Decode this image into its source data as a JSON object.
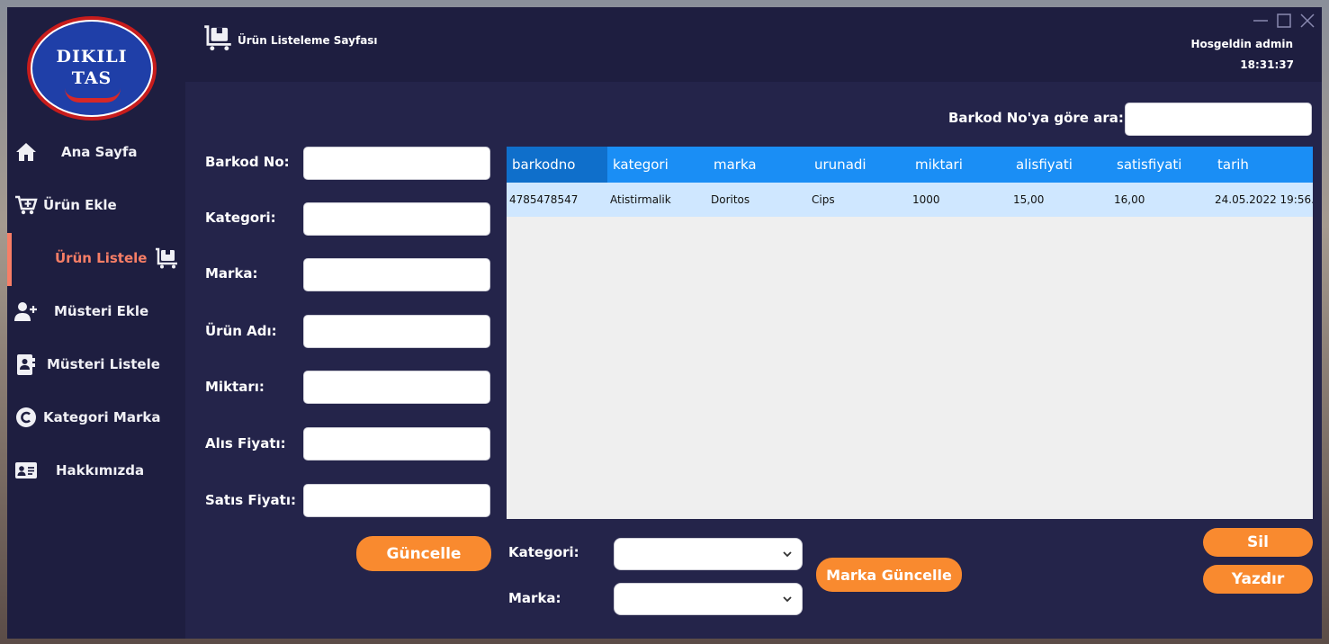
{
  "logo": {
    "line1": "DIKILI",
    "line2": "TAS"
  },
  "sidebar": {
    "items": [
      {
        "label": "Ana Sayfa",
        "icon": "home-icon"
      },
      {
        "label": "Ürün Ekle",
        "icon": "cart-plus-icon"
      },
      {
        "label": "Ürün Listele",
        "icon": "cart-flatbed-icon",
        "active": true
      },
      {
        "label": "Müsteri Ekle",
        "icon": "user-plus-icon"
      },
      {
        "label": "Müsteri Listele",
        "icon": "address-book-icon"
      },
      {
        "label": "Kategori Marka",
        "icon": "copyright-icon"
      },
      {
        "label": "Hakkımızda",
        "icon": "id-card-icon"
      }
    ]
  },
  "header": {
    "title": "Ürün Listeleme Sayfası",
    "icon": "cart-flatbed-icon",
    "welcome": "Hosgeldin admin",
    "time": "18:31:37"
  },
  "window_controls": [
    "minimize-icon",
    "maximize-icon",
    "close-icon"
  ],
  "form": {
    "fields": [
      {
        "label": "Barkod No:",
        "value": ""
      },
      {
        "label": "Kategori:",
        "value": ""
      },
      {
        "label": "Marka:",
        "value": ""
      },
      {
        "label": "Ürün Adı:",
        "value": ""
      },
      {
        "label": "Miktarı:",
        "value": ""
      },
      {
        "label": "Alıs Fiyatı:",
        "value": ""
      },
      {
        "label": "Satıs Fiyatı:",
        "value": ""
      }
    ],
    "update_button": "Güncelle"
  },
  "search": {
    "label": "Barkod No'ya göre ara:",
    "value": ""
  },
  "grid": {
    "columns": [
      "barkodno",
      "kategori",
      "marka",
      "urunadi",
      "miktari",
      "alisfiyati",
      "satisfiyati",
      "tarih"
    ],
    "rows": [
      [
        "4785478547",
        "Atistirmalik",
        "Doritos",
        "Cips",
        "1000",
        "15,00",
        "16,00",
        "24.05.2022 19:56..."
      ]
    ]
  },
  "bottom": {
    "category_label": "Kategori:",
    "brand_label": "Marka:",
    "category_value": "",
    "brand_value": "",
    "brand_update_button": "Marka Güncelle",
    "delete_button": "Sil",
    "print_button": "Yazdır"
  },
  "colors": {
    "background": "#24244a",
    "sidebar": "#1e1e40",
    "accent_orange": "#f98a2f",
    "active_nav": "#f77e66",
    "grid_header": "#1a8ef5",
    "grid_row": "#cfe7ff"
  }
}
